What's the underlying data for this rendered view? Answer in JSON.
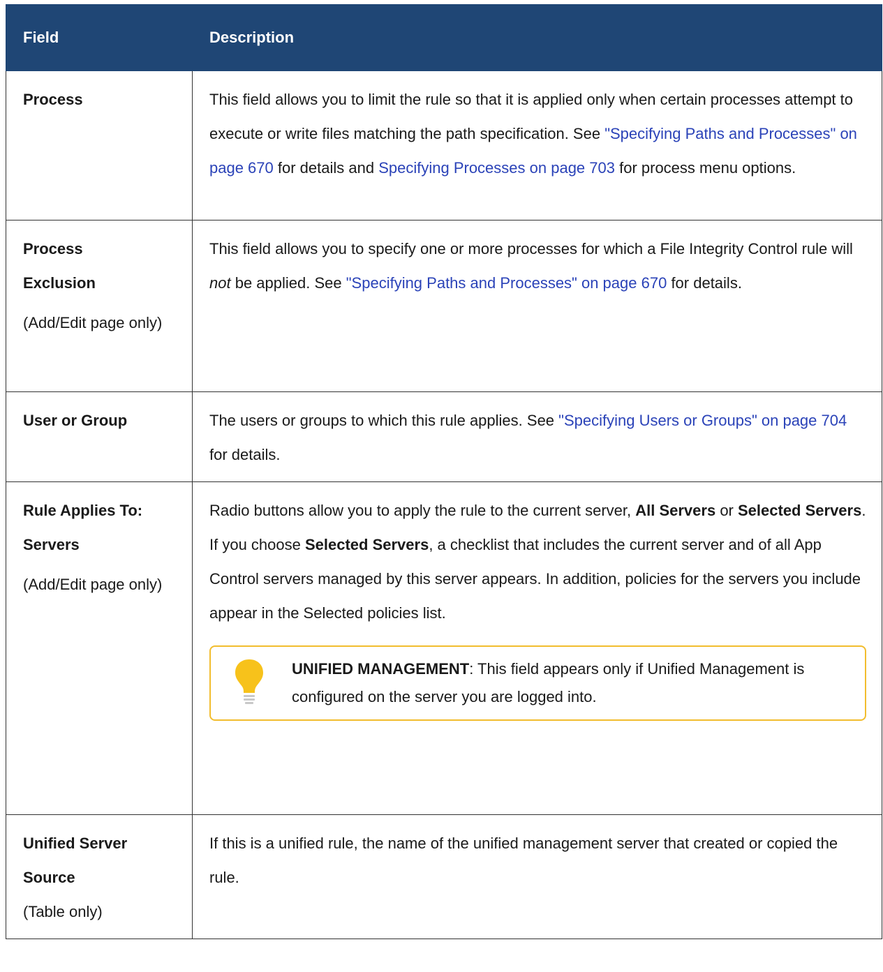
{
  "header": {
    "field": "Field",
    "description": "Description"
  },
  "rows": [
    {
      "field": "Process",
      "note": "",
      "desc_parts": [
        "This field allows you to limit the rule so that it is applied only when certain processes attempt to execute or write files matching the path specification. See ",
        "\"Specifying Paths and Processes\" on page 670",
        " for details and ",
        "Specifying Processes on page 703",
        " for process menu options."
      ]
    },
    {
      "field_line1": "Process",
      "field_line2": "Exclusion",
      "note": "(Add/Edit page only)",
      "desc_parts": [
        "This field allows you to specify one or more processes for which a File Integrity Control rule will ",
        "not",
        " be applied. See ",
        "\"Specifying Paths and Processes\" on page 670",
        " for details."
      ]
    },
    {
      "field": "User or Group",
      "desc_parts": [
        "The users or groups to which this rule applies. See ",
        "\"Specifying Users or Groups\" on page 704",
        " for details."
      ]
    },
    {
      "field_line1": "Rule Applies To:",
      "field_line2": "Servers",
      "note": "(Add/Edit page only)",
      "desc_parts": [
        "Radio buttons allow you to apply the rule to the current server, ",
        "All Servers",
        " or ",
        "Selected Servers",
        ". If you choose ",
        "Selected Servers",
        ", a checklist that includes the current server and of all App Control servers managed by this server appears. In addition, policies for the servers you include appear in the Selected policies list."
      ],
      "callout": {
        "icon": "lightbulb-icon",
        "label": "UNIFIED MANAGEMENT",
        "text": ": This field appears only if Unified Management is configured on the server you are logged into."
      }
    },
    {
      "field_line1": "Unified Server",
      "field_line2": "Source",
      "note": "(Table only)",
      "desc_parts": [
        "If this is a unified rule, the name of the unified management server that created or copied the rule."
      ]
    }
  ],
  "colors": {
    "header_bg": "#1f4675",
    "link": "#2b43b8",
    "callout_border": "#f2bd2e",
    "bulb": "#f7c21b"
  }
}
